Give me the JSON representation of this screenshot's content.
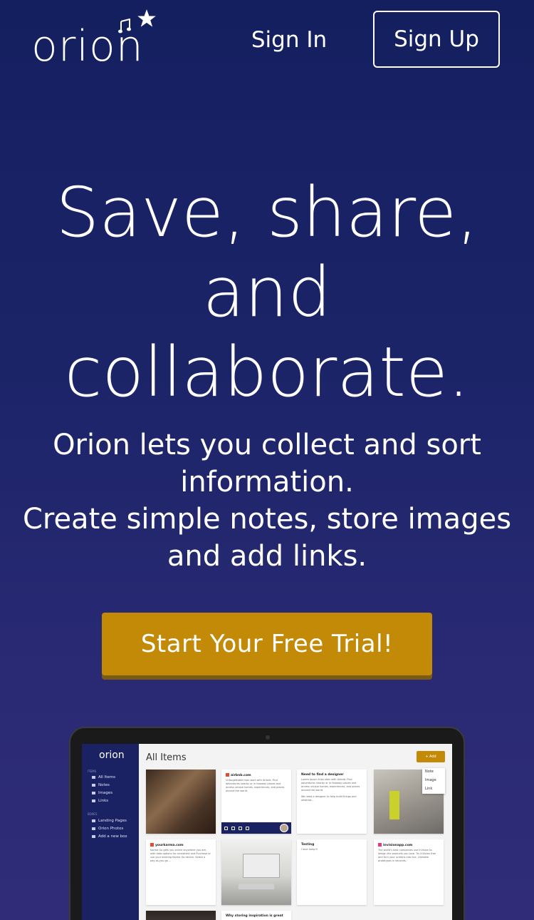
{
  "header": {
    "logo": "orion",
    "sign_in": "Sign In",
    "sign_up": "Sign Up"
  },
  "hero": {
    "title_line1": "Save, share,",
    "title_line2": "and",
    "title_line3": "collaborate.",
    "sub_line1": "Orion lets you collect and sort",
    "sub_line2": "information.",
    "sub_line3": "Create simple notes, store images",
    "sub_line4": "and add links.",
    "cta": "Start Your Free Trial!"
  },
  "app_preview": {
    "logo": "orion",
    "title": "All Items",
    "add_button": "+ Add",
    "dropdown": [
      "Note",
      "Image",
      "Link"
    ],
    "sidebar": {
      "section1": "Items",
      "items1": [
        "All Items",
        "Notes",
        "Images",
        "Links"
      ],
      "section2": "Boxes",
      "items2": [
        "Landing Pages",
        "Orion Photos",
        "Add a new box"
      ]
    },
    "cards": {
      "airbnb_title": "airbnb.com",
      "airbnb_body": "Unforgettable trips start with Airbnb. Find adventures nearby or in faraway places and access unique homes, experiences, and places around the world.",
      "designer_title": "Need to find a designer",
      "designer_body": "Lorem ipsum trips start with Airbnb. Find adventures nearby or in faraway places and access unique homes, experiences, and places around the world.",
      "designer_body2": "We need a designer to help build things and whatnot...",
      "karma_title": "yourkarma.com",
      "karma_body": "Karma Go gets you online anywhere you are, with data options for consistent and Purchase or use your existing Karma Go device. Select a pay-as-you-go ...",
      "testing_title": "Testing",
      "testing_body": "I love lamp!!!",
      "invision_title": "invisionapp.com",
      "invision_body": "The world's best companies use InVision to design the products you love. Try InVision free and turn your screens into live, clickable prototypes in seconds.",
      "inspiration_title": "Why storing inspiration is great"
    }
  },
  "colors": {
    "background_top": "#141f60",
    "background_bottom": "#302c78",
    "cta": "#c28a06",
    "app_sidebar": "#1b2264"
  }
}
